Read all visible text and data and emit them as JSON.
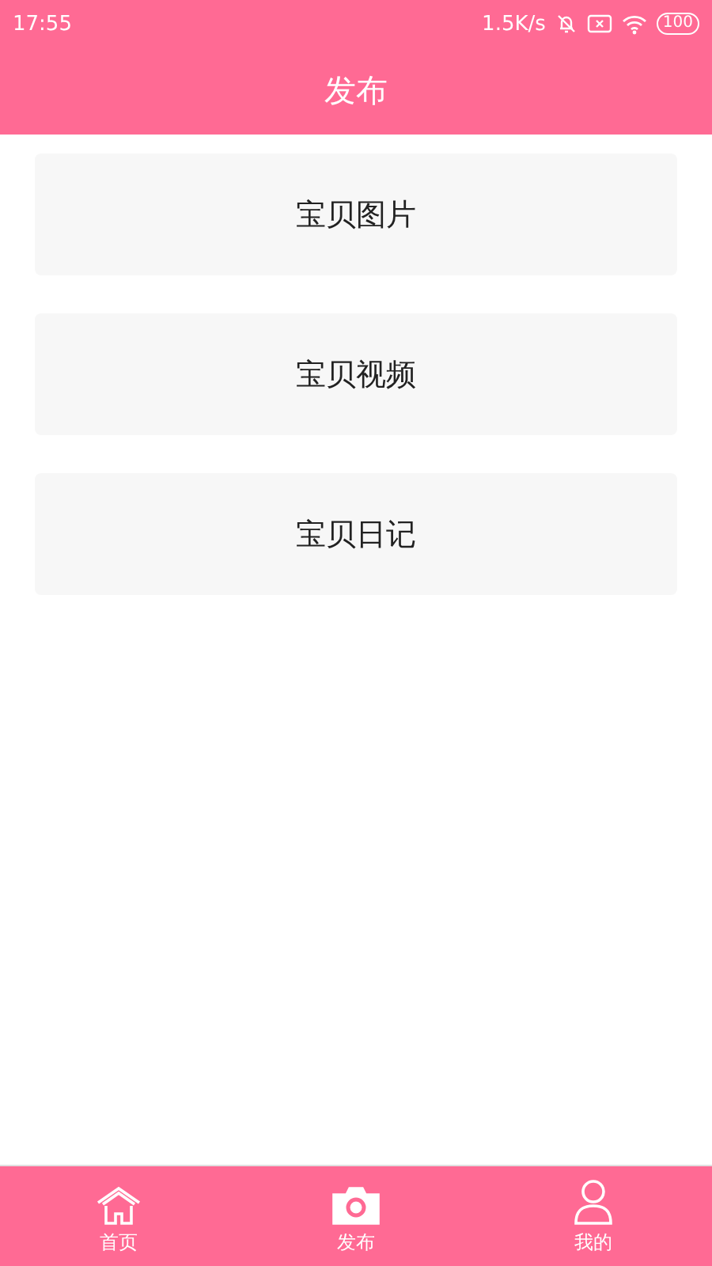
{
  "status_bar": {
    "time": "17:55",
    "speed": "1.5K/s",
    "battery": "100"
  },
  "header": {
    "title": "发布"
  },
  "options": [
    {
      "label": "宝贝图片"
    },
    {
      "label": "宝贝视频"
    },
    {
      "label": "宝贝日记"
    }
  ],
  "tab_bar": [
    {
      "kind": "home",
      "label": "首页",
      "selected": false
    },
    {
      "kind": "camera",
      "label": "发布",
      "selected": true
    },
    {
      "kind": "person",
      "label": "我的",
      "selected": false
    }
  ]
}
